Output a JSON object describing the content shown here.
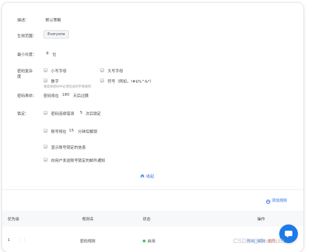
{
  "form": {
    "description": {
      "label": "描述：",
      "value": "默认策略"
    },
    "scope": {
      "label": "生效范围：",
      "tag": "Everyone"
    },
    "min_length": {
      "label": "最小长度：",
      "value": "8",
      "unit": "位"
    },
    "complexity": {
      "label_line1": "密码复杂",
      "label_line2": "度",
      "options": [
        {
          "label": "小写字母",
          "checked": true
        },
        {
          "label": "大写字母",
          "checked": true
        },
        {
          "label": "数字",
          "checked": true
        },
        {
          "label": "符号（例如，!#$%^&*）",
          "checked": true
        }
      ],
      "hint": "请选择密码中必须包含的字母规则"
    },
    "lifetime": {
      "label": "密码寿命：",
      "prefix": "密码将在",
      "value": "180",
      "suffix": "天后过期"
    },
    "lockout": {
      "label": "锁定：",
      "opt1": {
        "prefix": "密码连续错误",
        "value": "5",
        "suffix": "次后锁定"
      },
      "opt2": {
        "prefix": "账号将在",
        "value": "15",
        "suffix": "分钟后解锁"
      },
      "opt3": {
        "label": "显示账号锁定的信息"
      },
      "opt4": {
        "label": "向用户发送账号锁定的邮件通知"
      }
    },
    "collapse_label": "收起"
  },
  "rules": {
    "add_label": "添加规则",
    "columns": [
      "优先级",
      "规则名",
      "状态",
      "操作"
    ],
    "rows": [
      {
        "priority": "1",
        "name": "密码规则",
        "status": "启用",
        "ops": [
          "停用",
          "编辑",
          "删除"
        ]
      }
    ]
  },
  "colors": {
    "accent": "#2f6fe4",
    "danger": "#f04444",
    "status_on": "#34c759",
    "chat": "#1e7ae8"
  },
  "icons": {
    "chat": "chat-icon",
    "collapse": "chevron-up-icon",
    "drag": "drag-handle-icon",
    "add": "plus-circle-icon"
  },
  "watermark": "CSDN @OneAuth"
}
